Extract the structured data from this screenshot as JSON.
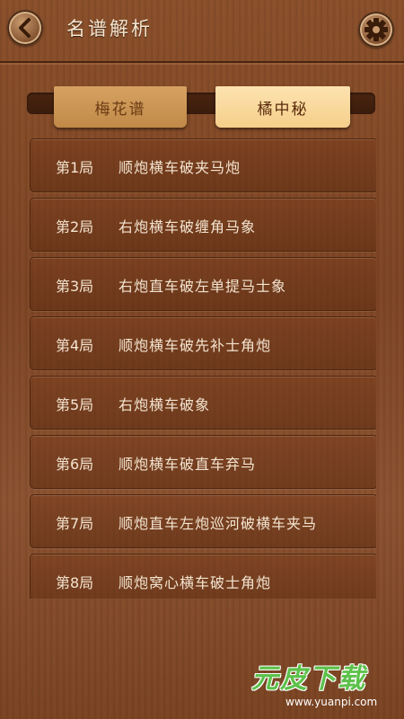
{
  "header": {
    "title": "名谱解析",
    "back_icon": "chevron-left-icon",
    "settings_icon": "gear-icon"
  },
  "tabs": [
    {
      "label": "梅花谱",
      "selected": false
    },
    {
      "label": "橘中秘",
      "selected": true
    }
  ],
  "games": [
    {
      "number": "第1局",
      "title": "顺炮横车破夹马炮"
    },
    {
      "number": "第2局",
      "title": "右炮横车破缠角马象"
    },
    {
      "number": "第3局",
      "title": "右炮直车破左单提马士象"
    },
    {
      "number": "第4局",
      "title": "顺炮横车破先补士角炮"
    },
    {
      "number": "第5局",
      "title": "右炮横车破象"
    },
    {
      "number": "第6局",
      "title": "顺炮横车破直车弃马"
    },
    {
      "number": "第7局",
      "title": "顺炮直车左炮巡河破横车夹马"
    },
    {
      "number": "第8局",
      "title": "顺炮窝心横车破士角炮"
    }
  ],
  "watermark": {
    "logo": "元皮下载",
    "url": "www.yuanpi.com"
  },
  "colors": {
    "accent_tab": "#f5cf8a",
    "text_light": "#f3e4d0",
    "watermark_green": "#5cc14a"
  }
}
